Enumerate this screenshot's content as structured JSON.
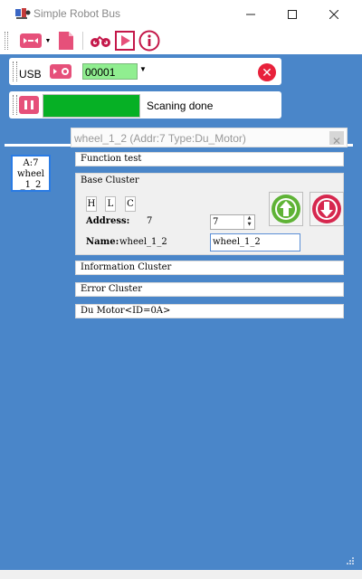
{
  "window": {
    "title": "Simple Robot Bus",
    "minimize_icon": "minimize-icon",
    "maximize_icon": "maximize-icon",
    "close_icon": "close-icon"
  },
  "toolbar": {
    "icons": [
      "connector-icon",
      "dropdown-arrow-icon",
      "new-document-icon",
      "bicycle-icon",
      "play-icon",
      "info-icon"
    ]
  },
  "connection": {
    "port_label": "USB",
    "device_id": "00001",
    "connect_icon": "usb-connector-icon",
    "disconnect_icon": "close-circle-icon"
  },
  "scan": {
    "progress": 1.0,
    "status": "Scaning done",
    "pause_icon": "pause-icon"
  },
  "node": {
    "line1": "A:7",
    "line2": "wheel",
    "line3": "_1_2"
  },
  "detail": {
    "title": "wheel_1_2   (Addr:7 Type:Du_Motor)",
    "function_test": "Function test",
    "base_cluster": {
      "header": "Base Cluster",
      "chips": [
        "H",
        "L",
        "C"
      ],
      "address_label": "Address:",
      "address_value": "7",
      "address_input": "7",
      "name_label": "Name:",
      "name_value": "wheel_1_2",
      "name_input": "wheel_1_2",
      "upload_icon": "upload-arrow-icon",
      "download_icon": "download-arrow-icon"
    },
    "information_cluster": "Information Cluster",
    "error_cluster": "Error Cluster",
    "motor_cluster": "Du Motor<ID=0A>"
  },
  "colors": {
    "background": "#4a86c9",
    "progress": "#06b025",
    "device_id_bg": "#90ee90",
    "accent_pink": "#e6507a",
    "close_red": "#e8213b",
    "upload_green": "#5fb336",
    "download_red": "#d6274e"
  }
}
